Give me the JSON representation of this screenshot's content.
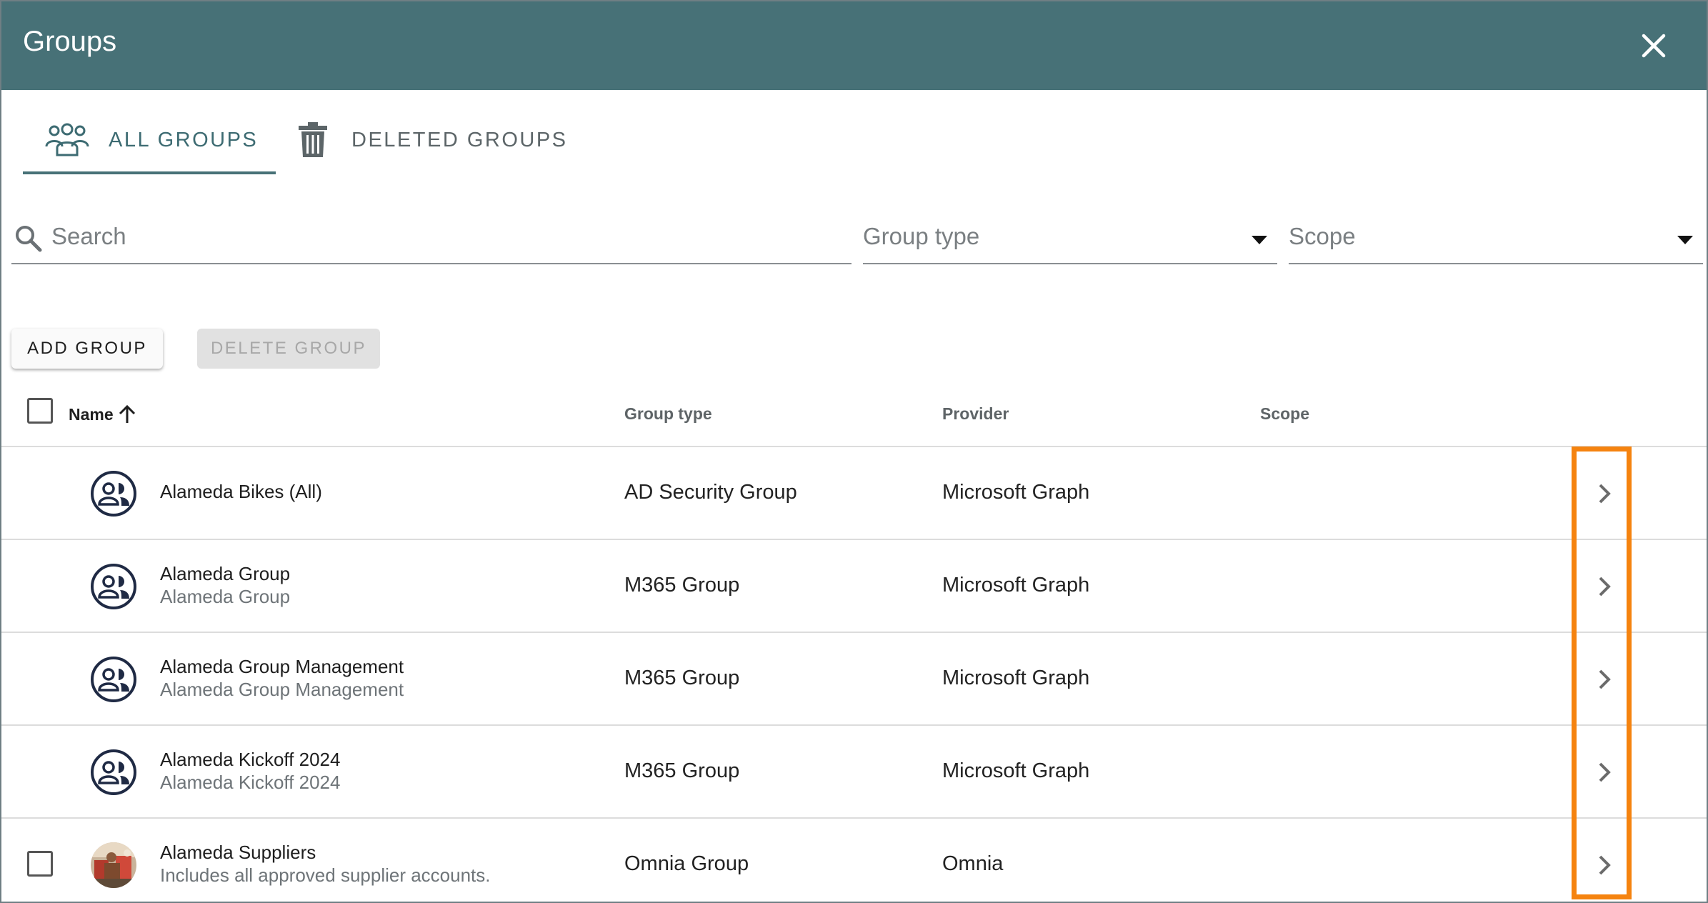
{
  "dialog": {
    "title": "Groups"
  },
  "tabs": [
    {
      "label": "ALL GROUPS",
      "icon": "users-icon",
      "active": true
    },
    {
      "label": "DELETED GROUPS",
      "icon": "trash-icon",
      "active": false
    }
  ],
  "filters": {
    "search_placeholder": "Search",
    "group_type_placeholder": "Group type",
    "scope_placeholder": "Scope"
  },
  "toolbar": {
    "add_label": "ADD GROUP",
    "delete_label": "DELETE GROUP"
  },
  "table": {
    "columns": {
      "name": "Name",
      "group_type": "Group type",
      "provider": "Provider",
      "scope": "Scope"
    },
    "rows": [
      {
        "title": "Alameda Bikes (All)",
        "subtitle": "",
        "group_type": "AD Security Group",
        "provider": "Microsoft Graph",
        "scope": "",
        "avatar": "group-avatar-icon",
        "has_checkbox": false
      },
      {
        "title": "Alameda Group",
        "subtitle": "Alameda Group",
        "group_type": "M365 Group",
        "provider": "Microsoft Graph",
        "scope": "",
        "avatar": "group-avatar-icon",
        "has_checkbox": false
      },
      {
        "title": "Alameda Group Management",
        "subtitle": "Alameda Group Management",
        "group_type": "M365 Group",
        "provider": "Microsoft Graph",
        "scope": "",
        "avatar": "group-avatar-icon",
        "has_checkbox": false
      },
      {
        "title": "Alameda Kickoff 2024",
        "subtitle": "Alameda Kickoff 2024",
        "group_type": "M365 Group",
        "provider": "Microsoft Graph",
        "scope": "",
        "avatar": "group-avatar-icon",
        "has_checkbox": false
      },
      {
        "title": "Alameda Suppliers",
        "subtitle": "Includes all approved supplier accounts.",
        "group_type": "Omnia Group",
        "provider": "Omnia",
        "scope": "",
        "avatar": "photo-avatar",
        "has_checkbox": true
      }
    ]
  },
  "colors": {
    "header": "#477177",
    "highlight": "#f5830f",
    "tab_active": "#3d6b72"
  }
}
